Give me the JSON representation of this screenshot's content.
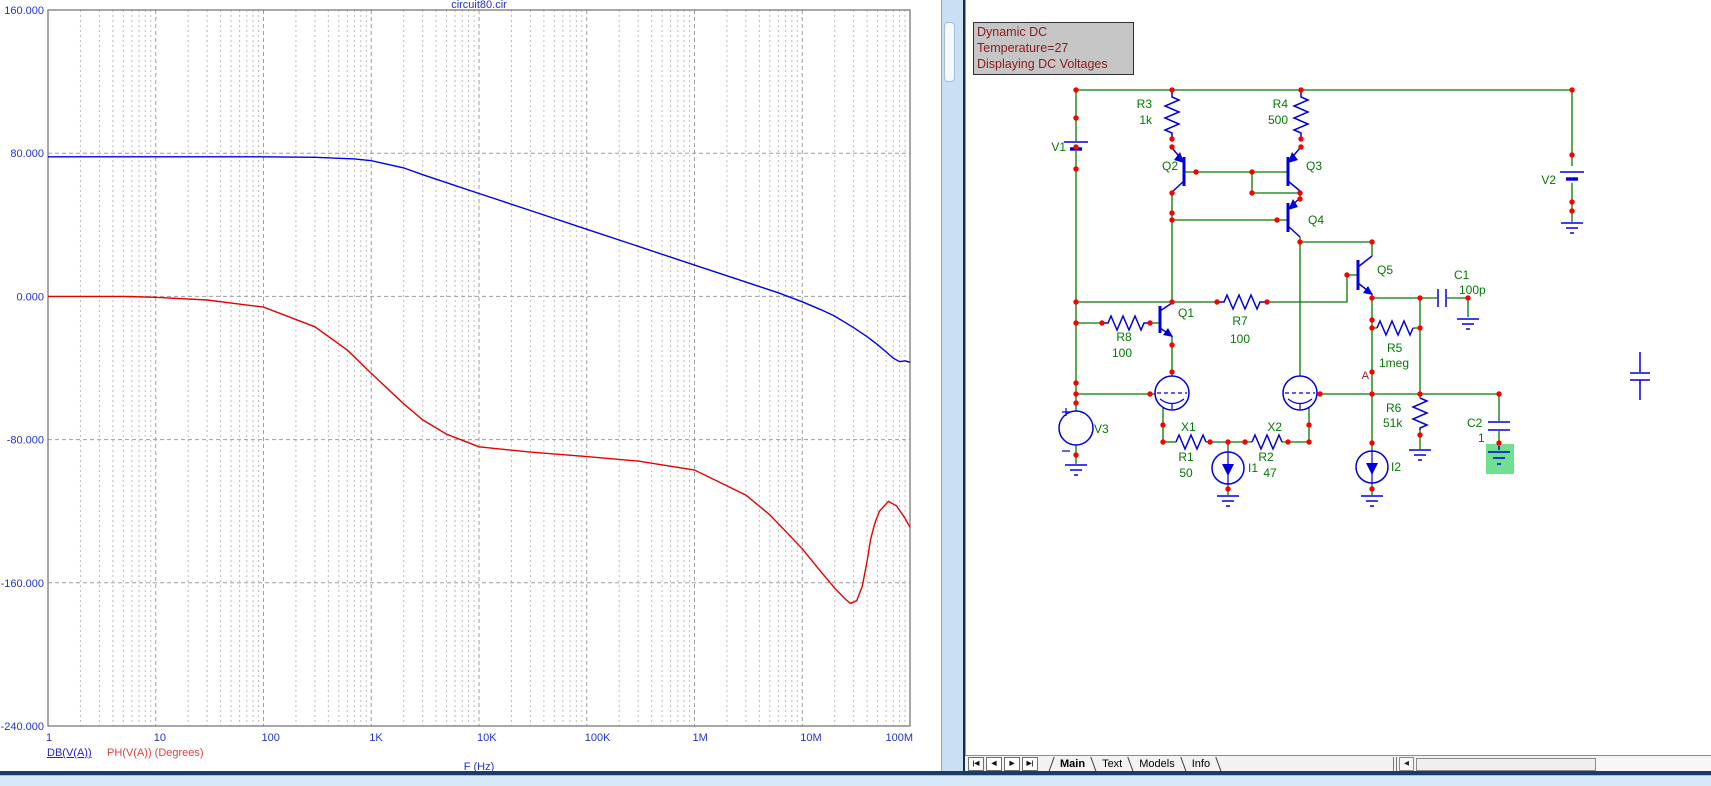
{
  "plot": {
    "title": "circuit80.cir",
    "legend": {
      "db": "DB(V(A))",
      "ph": "PH(V(A)) (Degrees)"
    },
    "xlabel": "F (Hz)"
  },
  "chart_data": {
    "type": "line",
    "title": "circuit80.cir",
    "x_scale": "log",
    "xlim": [
      1,
      100000000
    ],
    "ylim": [
      -240,
      160
    ],
    "xlabel": "F (Hz)",
    "grid": "dashed",
    "legend_position": "bottom-left",
    "x_ticks": [
      {
        "value": 1,
        "label": "1"
      },
      {
        "value": 10,
        "label": "10"
      },
      {
        "value": 100,
        "label": "100"
      },
      {
        "value": 1000,
        "label": "1K"
      },
      {
        "value": 10000,
        "label": "10K"
      },
      {
        "value": 100000,
        "label": "100K"
      },
      {
        "value": 1000000,
        "label": "1M"
      },
      {
        "value": 10000000,
        "label": "10M"
      },
      {
        "value": 100000000,
        "label": "100M"
      }
    ],
    "y_ticks": [
      {
        "value": 160,
        "label": "160.000"
      },
      {
        "value": 80,
        "label": "80.000"
      },
      {
        "value": 0,
        "label": "0.000"
      },
      {
        "value": -80,
        "label": "-80.000"
      },
      {
        "value": -160,
        "label": "-160.000"
      },
      {
        "value": -240,
        "label": "-240.000"
      }
    ],
    "series": [
      {
        "name": "DB(V(A))",
        "color": "#0000F0",
        "points": [
          [
            1,
            78
          ],
          [
            10,
            78
          ],
          [
            100,
            78
          ],
          [
            300,
            77.7
          ],
          [
            700,
            76.8
          ],
          [
            1000,
            75.8
          ],
          [
            2000,
            71.8
          ],
          [
            3000,
            68
          ],
          [
            5000,
            63.5
          ],
          [
            10000,
            57.5
          ],
          [
            30000,
            48
          ],
          [
            100000,
            37.5
          ],
          [
            300000,
            28
          ],
          [
            1000000,
            17.5
          ],
          [
            3000000,
            8
          ],
          [
            6000000,
            2
          ],
          [
            10000000,
            -3
          ],
          [
            15000000,
            -7.5
          ],
          [
            20000000,
            -11
          ],
          [
            30000000,
            -17.5
          ],
          [
            40000000,
            -22.5
          ],
          [
            50000000,
            -27
          ],
          [
            60000000,
            -31
          ],
          [
            70000000,
            -34.5
          ],
          [
            80000000,
            -36.5
          ],
          [
            90000000,
            -36
          ],
          [
            100000000,
            -36.8
          ]
        ]
      },
      {
        "name": "PH(V(A)) (Degrees)",
        "color": "#E80000",
        "points": [
          [
            1,
            0
          ],
          [
            5,
            0
          ],
          [
            10,
            -0.5
          ],
          [
            30,
            -2
          ],
          [
            100,
            -6
          ],
          [
            300,
            -17
          ],
          [
            600,
            -30
          ],
          [
            1000,
            -43
          ],
          [
            2000,
            -60
          ],
          [
            3000,
            -69
          ],
          [
            5000,
            -77
          ],
          [
            10000,
            -84
          ],
          [
            30000,
            -87
          ],
          [
            100000,
            -89.5
          ],
          [
            300000,
            -92
          ],
          [
            1000000,
            -97
          ],
          [
            3000000,
            -111
          ],
          [
            5000000,
            -122
          ],
          [
            10000000,
            -141
          ],
          [
            15000000,
            -154
          ],
          [
            20000000,
            -163
          ],
          [
            25000000,
            -169
          ],
          [
            28000000,
            -171.5
          ],
          [
            32000000,
            -170
          ],
          [
            36000000,
            -162
          ],
          [
            40000000,
            -148
          ],
          [
            43000000,
            -136
          ],
          [
            47000000,
            -127
          ],
          [
            52000000,
            -120
          ],
          [
            63000000,
            -114.5
          ],
          [
            75000000,
            -117
          ],
          [
            90000000,
            -124
          ],
          [
            100000000,
            -129
          ]
        ]
      }
    ]
  },
  "schematic": {
    "info": {
      "line1": "Dynamic DC",
      "line2": "Temperature=27",
      "line3": "Displaying DC Voltages"
    },
    "components": {
      "V1": "V1",
      "V2": "V2",
      "V3": "V3",
      "Q1": "Q1",
      "Q2": "Q2",
      "Q3": "Q3",
      "Q4": "Q4",
      "Q5": "Q5",
      "X1": "X1",
      "X2": "X2",
      "I1": "I1",
      "I2": "I2",
      "R1": "R1",
      "R1_val": "50",
      "R2": "R2",
      "R2_val": "47",
      "R3": "R3",
      "R3_val": "1k",
      "R4": "R4",
      "R4_val": "500",
      "R5": "R5",
      "R5_val": "1meg",
      "R6": "R6",
      "R6_val": "51k",
      "R7": "R7",
      "R7_val": "100",
      "R8": "R8",
      "R8_val": "100",
      "C1": "C1",
      "C1_val": "100p",
      "C2": "C2",
      "C2_val": "1",
      "node_a": "A"
    },
    "nav_buttons": [
      "|◀",
      "◀",
      "▶",
      "▶|"
    ],
    "tabs": [
      {
        "label": "Main",
        "active": true
      },
      {
        "label": "Text",
        "active": false
      },
      {
        "label": "Models",
        "active": false
      },
      {
        "label": "Info",
        "active": false
      }
    ],
    "scroll_left_arrow": "◀"
  },
  "colors": {
    "wire": "#007A00",
    "component": "#0000DD",
    "junction": "#FA0000",
    "label": "#007A00",
    "maroon": "#8B1A1A",
    "axis_text": "#2233CC",
    "curve_db": "#0000F0",
    "curve_ph": "#E80000",
    "highlight_green": "#6FE08F"
  }
}
